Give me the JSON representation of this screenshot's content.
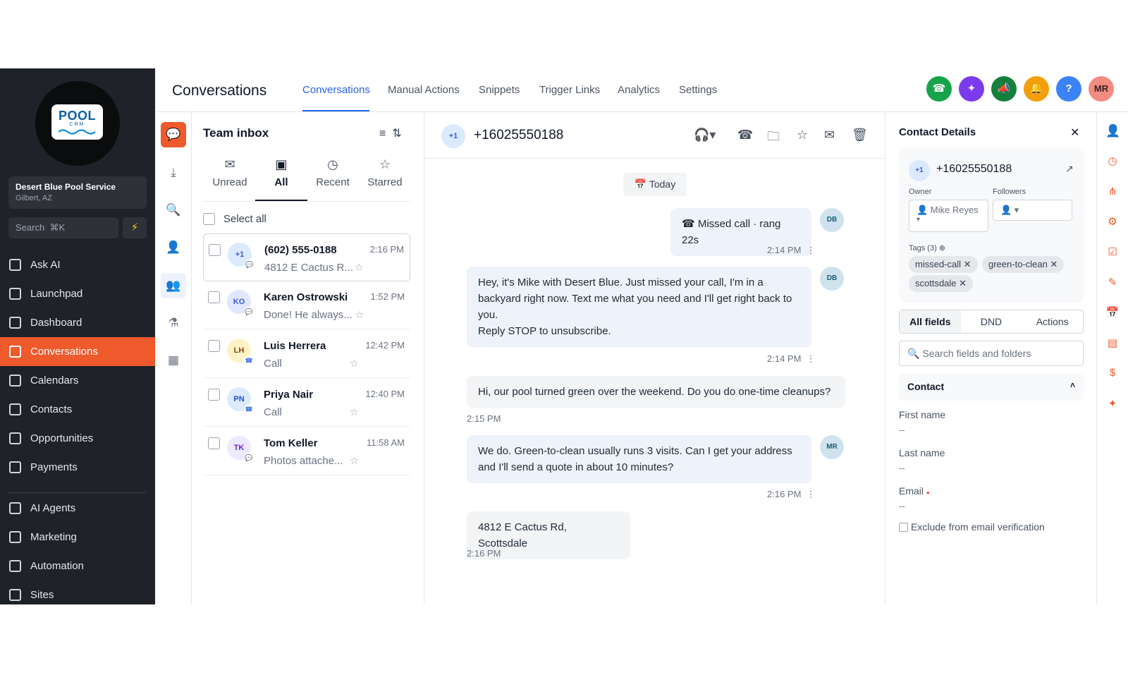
{
  "sidebar": {
    "logo_main": "POOL",
    "logo_sub": "CRM",
    "location_name": "Desert Blue Pool Service",
    "location_city": "Gilbert, AZ",
    "search_label": "Search",
    "search_shortcut": "⌘K",
    "bolt_icon": "⚡",
    "items": [
      {
        "label": "Ask AI"
      },
      {
        "label": "Launchpad"
      },
      {
        "label": "Dashboard"
      },
      {
        "label": "Conversations"
      },
      {
        "label": "Calendars"
      },
      {
        "label": "Contacts"
      },
      {
        "label": "Opportunities"
      },
      {
        "label": "Payments"
      },
      {
        "label": "AI Agents"
      },
      {
        "label": "Marketing"
      },
      {
        "label": "Automation"
      },
      {
        "label": "Sites"
      }
    ]
  },
  "header": {
    "title": "Conversations",
    "tabs": [
      {
        "label": "Conversations"
      },
      {
        "label": "Manual Actions"
      },
      {
        "label": "Snippets"
      },
      {
        "label": "Trigger Links"
      },
      {
        "label": "Analytics"
      },
      {
        "label": "Settings"
      }
    ],
    "buttons": {
      "phone": {
        "glyph": "☎",
        "color": "#16a34a"
      },
      "ai": {
        "glyph": "✦",
        "color": "#7c3aed"
      },
      "announce": {
        "glyph": "📣",
        "color": "#15803d"
      },
      "bell": {
        "glyph": "🔔",
        "color": "#f59e0b"
      },
      "help": {
        "glyph": "?",
        "color": "#3b82f6"
      },
      "avatar": {
        "glyph": "MR",
        "color": "#f28b82"
      }
    }
  },
  "rail": {
    "chat_icon": "💬",
    "download_icon": "⤓",
    "search_icon": "🔍",
    "person_icon": "👤",
    "team_icon": "👥",
    "filter_icon": "⚗",
    "grid_icon": "▦"
  },
  "inbox": {
    "title": "Team inbox",
    "menu_icon": "≡",
    "sort_icon": "⇅",
    "filters": [
      {
        "icon": "✉",
        "label": "Unread"
      },
      {
        "icon": "▣",
        "label": "All"
      },
      {
        "icon": "◷",
        "label": "Recent"
      },
      {
        "icon": "☆",
        "label": "Starred"
      }
    ],
    "select_all": "Select all",
    "star_icon": "☆",
    "conversations": [
      {
        "initials": "+1",
        "name": "(602) 555-0188",
        "time": "2:16 PM",
        "preview": "4812 E Cactus R...",
        "channel": "💬"
      },
      {
        "initials": "KO",
        "name": "Karen Ostrowski",
        "time": "1:52 PM",
        "preview": "Done! He always...",
        "channel": "💬"
      },
      {
        "initials": "LH",
        "name": "Luis Herrera",
        "time": "12:42 PM",
        "preview": "Call",
        "channel": "☎"
      },
      {
        "initials": "PN",
        "name": "Priya Nair",
        "time": "12:40 PM",
        "preview": "Call",
        "channel": "☎"
      },
      {
        "initials": "TK",
        "name": "Tom Keller",
        "time": "11:58 AM",
        "preview": "Photos attache...",
        "channel": "💬"
      }
    ]
  },
  "chat": {
    "avatar": "+1",
    "number": "+16025550188",
    "icons": {
      "headset": "🎧▾",
      "phone": "☎",
      "folder": "🗀",
      "star": "☆",
      "mail": "✉",
      "trash": "🗑"
    },
    "today_label": "📅 Today",
    "more_icon": "⋮",
    "messages": [
      {
        "text": "☎ Missed call · rang 22s",
        "time": "2:14 PM",
        "avatar": "DB"
      },
      {
        "text": "Hey, it's Mike with Desert Blue. Just missed your call, I'm in a backyard right now. Text me what you need and I'll get right back to you.",
        "text2": "Reply STOP to unsubscribe.",
        "time": "2:14 PM",
        "avatar": "DB"
      },
      {
        "text": "Hi, our pool turned green over the weekend. Do you do one-time cleanups?",
        "time": "2:15 PM"
      },
      {
        "text": "We do. Green-to-clean usually runs 3 visits. Can I get your address and I'll send a quote in about 10 minutes?",
        "time": "2:16 PM",
        "avatar": "MR"
      },
      {
        "text": "4812 E Cactus Rd, Scottsdale",
        "time": "2:16 PM"
      }
    ]
  },
  "details": {
    "title": "Contact Details",
    "close_icon": "✕",
    "avatar": "+1",
    "number": "+16025550188",
    "open_icon": "↗",
    "owner_label": "Owner",
    "owner_value": "👤 Mike Reyes",
    "owner_caret": "▾",
    "followers_label": "Followers",
    "followers_value": "👤 ▾",
    "tags_label": "Tags (3) ⊕",
    "tags": [
      "missed-call ✕",
      "green-to-clean ✕",
      "scottsdale ✕"
    ],
    "segments": [
      "All fields",
      "DND",
      "Actions"
    ],
    "search_placeholder": "🔍 Search fields and folders",
    "section": "Contact",
    "section_caret": "˄",
    "fields": [
      {
        "label": "First name",
        "value": "--"
      },
      {
        "label": "Last name",
        "value": "--"
      },
      {
        "label": "Email",
        "value": "--"
      }
    ],
    "required_mark": "●",
    "exclude_label": "Exclude from email verification"
  },
  "right_rail": [
    "👤",
    "◷",
    "⋔",
    "⚙",
    "☑",
    "✎",
    "📅",
    "▤",
    "$",
    "✦"
  ]
}
